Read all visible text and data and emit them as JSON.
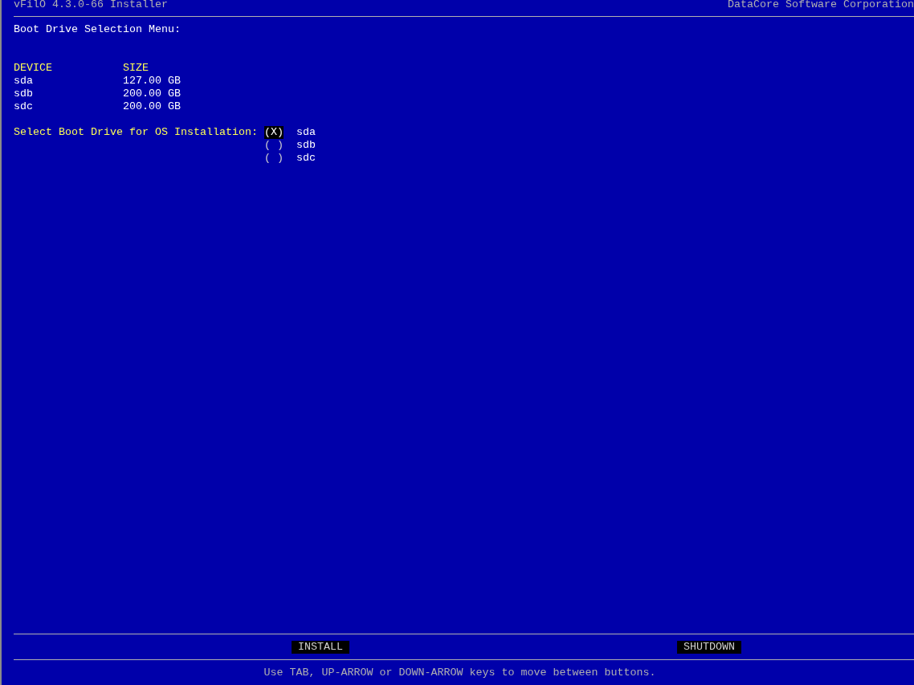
{
  "header": {
    "title": "vFilO 4.3.0-66 Installer",
    "vendor": "DataCore Software Corporation"
  },
  "menu_title": "Boot Drive Selection Menu:",
  "table": {
    "columns": [
      "DEVICE",
      "SIZE"
    ],
    "rows": [
      {
        "device": "sda",
        "size": "127.00 GB"
      },
      {
        "device": "sdb",
        "size": "200.00 GB"
      },
      {
        "device": "sdc",
        "size": "200.00 GB"
      }
    ]
  },
  "boot_drive": {
    "label": "Select Boot Drive for OS Installation:",
    "mark_on": "(X)",
    "mark_off": "( )",
    "options": [
      {
        "label": "sda",
        "selected": true
      },
      {
        "label": "sdb",
        "selected": false
      },
      {
        "label": "sdc",
        "selected": false
      }
    ]
  },
  "buttons": [
    "INSTALL",
    "SHUTDOWN"
  ],
  "help": "Use TAB, UP-ARROW or DOWN-ARROW keys to move between buttons."
}
